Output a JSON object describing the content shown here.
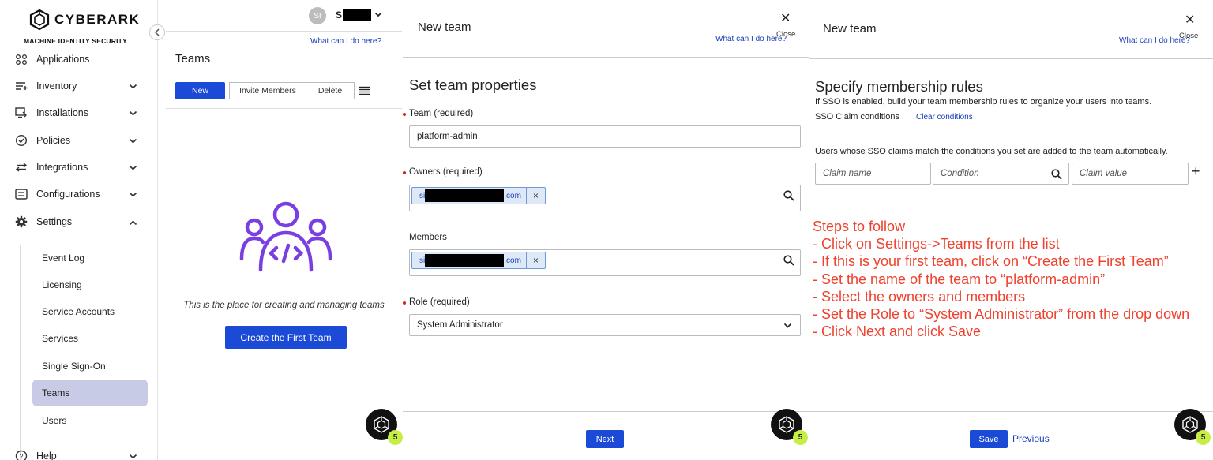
{
  "brand": {
    "name": "CYBERARK",
    "tagline": "MACHINE IDENTITY SECURITY"
  },
  "sidebar": {
    "items": [
      {
        "label": "Applications",
        "icon": "apps-icon"
      },
      {
        "label": "Inventory",
        "icon": "inventory-icon"
      },
      {
        "label": "Installations",
        "icon": "installations-icon"
      },
      {
        "label": "Policies",
        "icon": "policies-icon"
      },
      {
        "label": "Integrations",
        "icon": "integrations-icon"
      },
      {
        "label": "Configurations",
        "icon": "configurations-icon"
      },
      {
        "label": "Settings",
        "icon": "gear-icon"
      },
      {
        "label": "Help",
        "icon": "help-icon"
      }
    ],
    "settings_sub": [
      "Event Log",
      "Licensing",
      "Service Accounts",
      "Services",
      "Single Sign-On",
      "Teams",
      "Users"
    ],
    "active_sub": "Teams"
  },
  "user": {
    "initials": "SI",
    "name_prefix": "S"
  },
  "help_link": "What can I do here?",
  "teams_page": {
    "title": "Teams",
    "toolbar": {
      "new": "New",
      "invite": "Invite Members",
      "delete": "Delete"
    },
    "empty_text": "This is the place for creating and managing teams",
    "create_first": "Create the First Team"
  },
  "chat_badge": "5",
  "panel1": {
    "title": "New team",
    "close": "Close",
    "section": "Set team properties",
    "team_label": "Team (required)",
    "team_value": "platform-admin",
    "owners_label": "Owners (required)",
    "owner_chip": {
      "prefix": "si",
      "suffix": ".com"
    },
    "members_label": "Members",
    "member_chip": {
      "prefix": "si",
      "suffix": ".com"
    },
    "role_label": "Role (required)",
    "role_value": "System Administrator",
    "next": "Next"
  },
  "panel2": {
    "title": "New team",
    "close": "Close",
    "section": "Specify membership rules",
    "desc": "If SSO is enabled, build your team membership rules to organize your users into teams.",
    "sso_label": "SSO Claim conditions",
    "clear": "Clear conditions",
    "info": "Users whose SSO claims match the conditions you set are added to the team automatically.",
    "claim_name": "Claim name",
    "condition": "Condition",
    "claim_value": "Claim value",
    "save": "Save",
    "previous": "Previous"
  },
  "steps": [
    "Steps to follow",
    "- Click on Settings->Teams from the list",
    "- If this is your first team, click on “Create the First Team”",
    "- Set the name of the team to “platform-admin”",
    "- Select the owners and members",
    "- Set the Role to “System Administrator” from the drop down",
    "- Click Next and click Save"
  ],
  "colors": {
    "primary": "#1b4ad6",
    "accent_purple": "#7a3fe0",
    "annotation_red": "#f0412e",
    "active_nav": "#c7cbe6",
    "badge": "#c6ee44"
  }
}
